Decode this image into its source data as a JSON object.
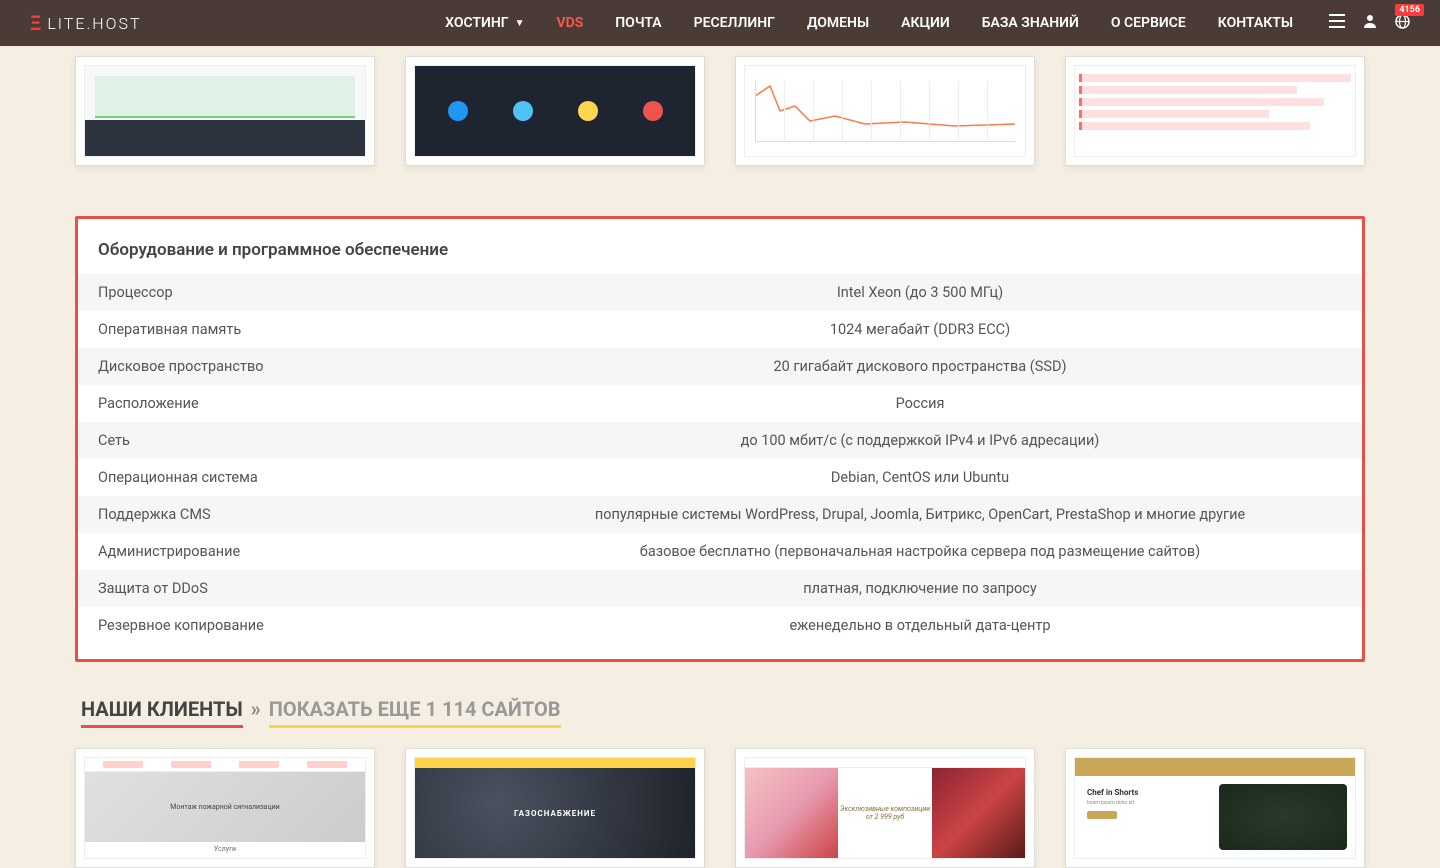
{
  "brand": {
    "name": "LITE.HOST"
  },
  "nav": {
    "items": [
      {
        "label": "ХОСТИНГ",
        "has_dropdown": true
      },
      {
        "label": "VDS",
        "active": true
      },
      {
        "label": "ПОЧТА"
      },
      {
        "label": "РЕСЕЛЛИНГ"
      },
      {
        "label": "ДОМЕНЫ"
      },
      {
        "label": "АКЦИИ"
      },
      {
        "label": "БАЗА ЗНАНИЙ"
      },
      {
        "label": "О СЕРВИСЕ"
      },
      {
        "label": "КОНТАКТЫ"
      }
    ],
    "badge_count": "4156"
  },
  "specs": {
    "title": "Оборудование и программное обеспечение",
    "rows": [
      {
        "label": "Процессор",
        "value": "Intel Xeon (до 3 500 МГц)"
      },
      {
        "label": "Оперативная память",
        "value": "1024 мегабайт (DDR3 ECC)"
      },
      {
        "label": "Дисковое пространство",
        "value": "20 гигабайт дискового пространства (SSD)"
      },
      {
        "label": "Расположение",
        "value": "Россия"
      },
      {
        "label": "Сеть",
        "value": "до 100 мбит/с (с поддержкой IPv4 и IPv6 адресации)"
      },
      {
        "label": "Операционная система",
        "value": "Debian, CentOS или Ubuntu"
      },
      {
        "label": "Поддержка CMS",
        "value": "популярные системы WordPress, Drupal, Joomla, Битрикс, OpenCart, PrestaShop и многие другие"
      },
      {
        "label": "Администрирование",
        "value": "базовое бесплатно (первоначальная настройка сервера под размещение сайтов)"
      },
      {
        "label": "Защита от DDoS",
        "value": "платная, подключение по запросу"
      },
      {
        "label": "Резервное копирование",
        "value": "еженедельно в отдельный дата-центр"
      }
    ]
  },
  "clients": {
    "title": "НАШИ КЛИЕНТЫ",
    "arrow": "»",
    "more": "ПОКАЗАТЬ ЕЩЕ 1 114 САЙТОВ",
    "thumbs": {
      "c1_text": "Монтаж пожарной\nсигнализации",
      "c1_foot": "Услуги",
      "c2_text": "ГАЗОСНАБЖЕНИЕ",
      "c3_script": "Эксклюзивные композиции",
      "c3_price": "от 2 999 руб",
      "c4_title": "Chef in Shorts"
    }
  }
}
